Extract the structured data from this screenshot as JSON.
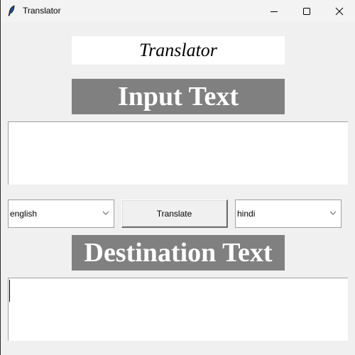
{
  "window": {
    "title": "Translator",
    "icon": "feather-icon",
    "controls": [
      "minimize-icon",
      "maximize-icon",
      "close-icon"
    ]
  },
  "app": {
    "heading": "Translator",
    "input_label": "Input Text",
    "input_text": "",
    "source_language": "english",
    "translate_button": "Translate",
    "target_language": "hindi",
    "destination_label": "Destination Text",
    "output_text": ""
  },
  "colors": {
    "background": "#f0f0f0",
    "label_background": "#808080",
    "label_text": "#ffffff",
    "heading_background": "#ffffff"
  }
}
